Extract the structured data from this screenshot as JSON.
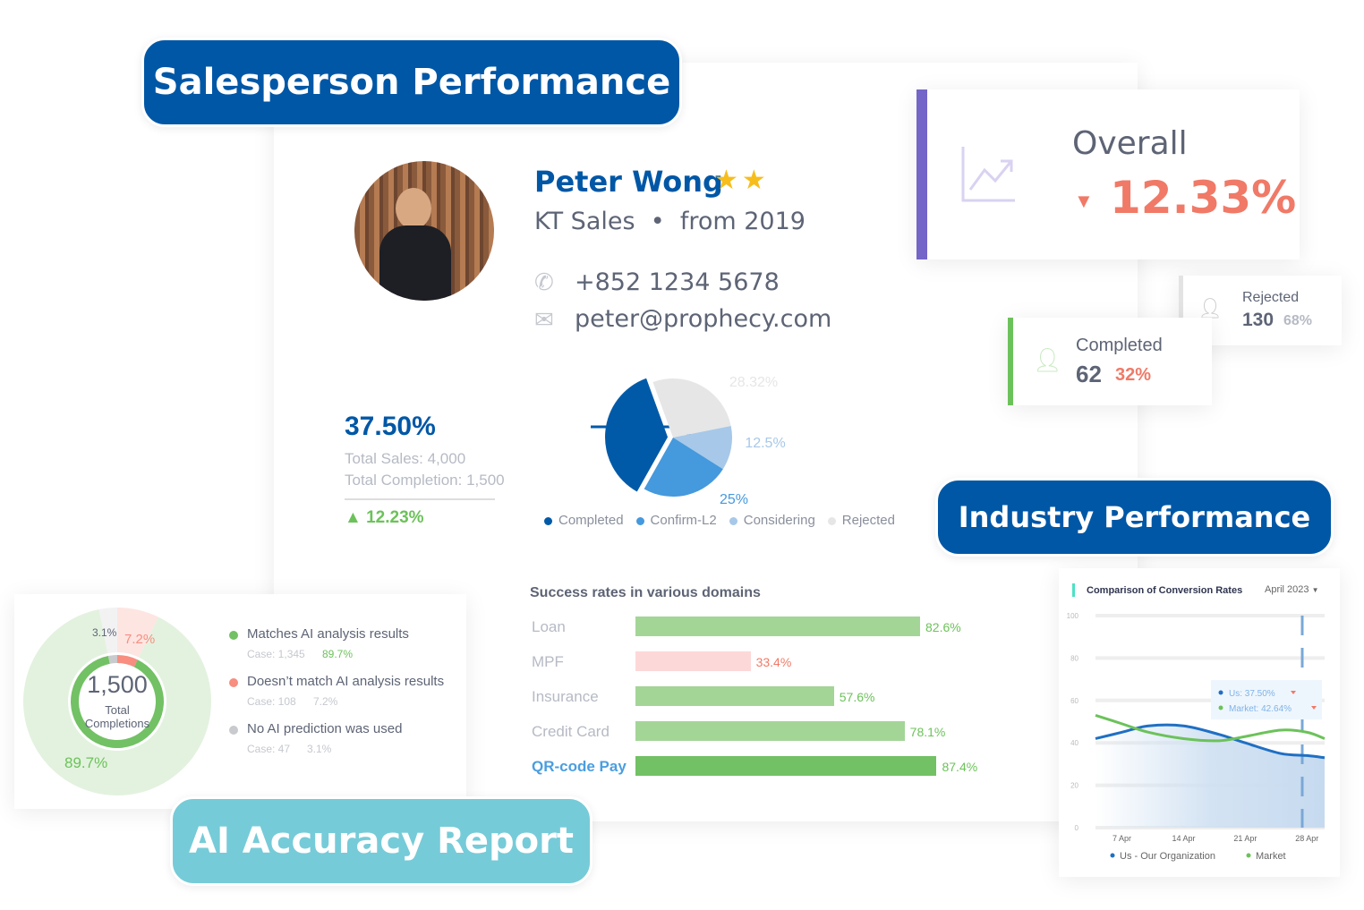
{
  "labels": {
    "salesperson": "Salesperson Performance",
    "industry": "Industry Performance",
    "ai": "AI Accuracy Report"
  },
  "profile": {
    "name": "Peter Wong",
    "stars": 2,
    "company": "KT Sales",
    "since": "from 2019",
    "phone": "+852 1234 5678",
    "email": "peter@prophecy.com"
  },
  "overall": {
    "label": "Overall",
    "value": "12.33%",
    "trend": "down"
  },
  "completed": {
    "label": "Completed",
    "count": "62",
    "pct": "32%"
  },
  "rejected": {
    "label": "Rejected",
    "count": "130",
    "pct": "68%"
  },
  "summary": {
    "rate": "37.50%",
    "sales": "Total Sales: 4,000",
    "completion": "Total Completion: 1,500",
    "change": "12.23%"
  },
  "pie": {
    "slices": [
      {
        "name": "Rejected",
        "value": 28.32,
        "label": "28.32%",
        "color": "#e6e6e6"
      },
      {
        "name": "Considering",
        "value": 12.5,
        "label": "12.5%",
        "color": "#a7c8e8"
      },
      {
        "name": "Confirm-L2",
        "value": 25,
        "label": "25%",
        "color": "#4599dd"
      },
      {
        "name": "Completed",
        "value": 37.5,
        "label": "",
        "color": "#005aa8"
      }
    ],
    "legend": [
      "Completed",
      "Confirm-L2",
      "Considering",
      "Rejected"
    ]
  },
  "domains": {
    "title": "Success rates in various domains",
    "rows": [
      {
        "name": "Loan",
        "value": 82.6,
        "label": "82.6%",
        "color": "#a3d597"
      },
      {
        "name": "MPF",
        "value": 33.4,
        "label": "33.4%",
        "color": "#fdd8d8"
      },
      {
        "name": "Insurance",
        "value": 57.6,
        "label": "57.6%",
        "color": "#a3d597"
      },
      {
        "name": "Credit Card",
        "value": 78.1,
        "label": "78.1%",
        "color": "#a3d597"
      },
      {
        "name": "QR-code Pay",
        "value": 87.4,
        "label": "87.4%",
        "color": "#72c164",
        "highlight": true
      }
    ]
  },
  "accuracy": {
    "total": "1,500",
    "total_label1": "Total",
    "total_label2": "Completions",
    "outer": {
      "match": "89.7%",
      "nomatch": "7.2%",
      "none": "3.1%"
    },
    "items": [
      {
        "label": "Matches AI analysis results",
        "case": "Case: 1,345",
        "pct": "89.7%",
        "color": "#72c164"
      },
      {
        "label": "Doesn’t match AI analysis results",
        "case": "Case: 108",
        "pct": "7.2%",
        "color": "#f78e80"
      },
      {
        "label": "No AI prediction was used",
        "case": "Case: 47",
        "pct": "3.1%",
        "color": "#c8cacd"
      }
    ]
  },
  "chart_data": {
    "type": "line",
    "title": "Comparison of Conversion Rates",
    "period": "April 2023",
    "ylim": [
      0,
      100
    ],
    "yticks": [
      "0",
      "20",
      "40",
      "60",
      "80",
      "100"
    ],
    "xticks": [
      "7 Apr",
      "14 Apr",
      "21 Apr",
      "28 Apr"
    ],
    "x": [
      "4 Apr",
      "7 Apr",
      "10 Apr",
      "14 Apr",
      "18 Apr",
      "21 Apr",
      "25 Apr",
      "28 Apr",
      "30 Apr"
    ],
    "series": [
      {
        "name": "Us - Our Organization",
        "color": "#1f6fc4",
        "values": [
          42,
          45,
          48,
          48,
          44,
          40,
          35,
          34,
          33
        ]
      },
      {
        "name": "Market",
        "color": "#6cc25a",
        "values": [
          53,
          49,
          45,
          42,
          41,
          43,
          46,
          45,
          42
        ]
      }
    ],
    "tooltip": {
      "us": "Us: 37.50%",
      "market": "Market: 42.64%"
    },
    "legend": "bottom",
    "grid": true
  }
}
